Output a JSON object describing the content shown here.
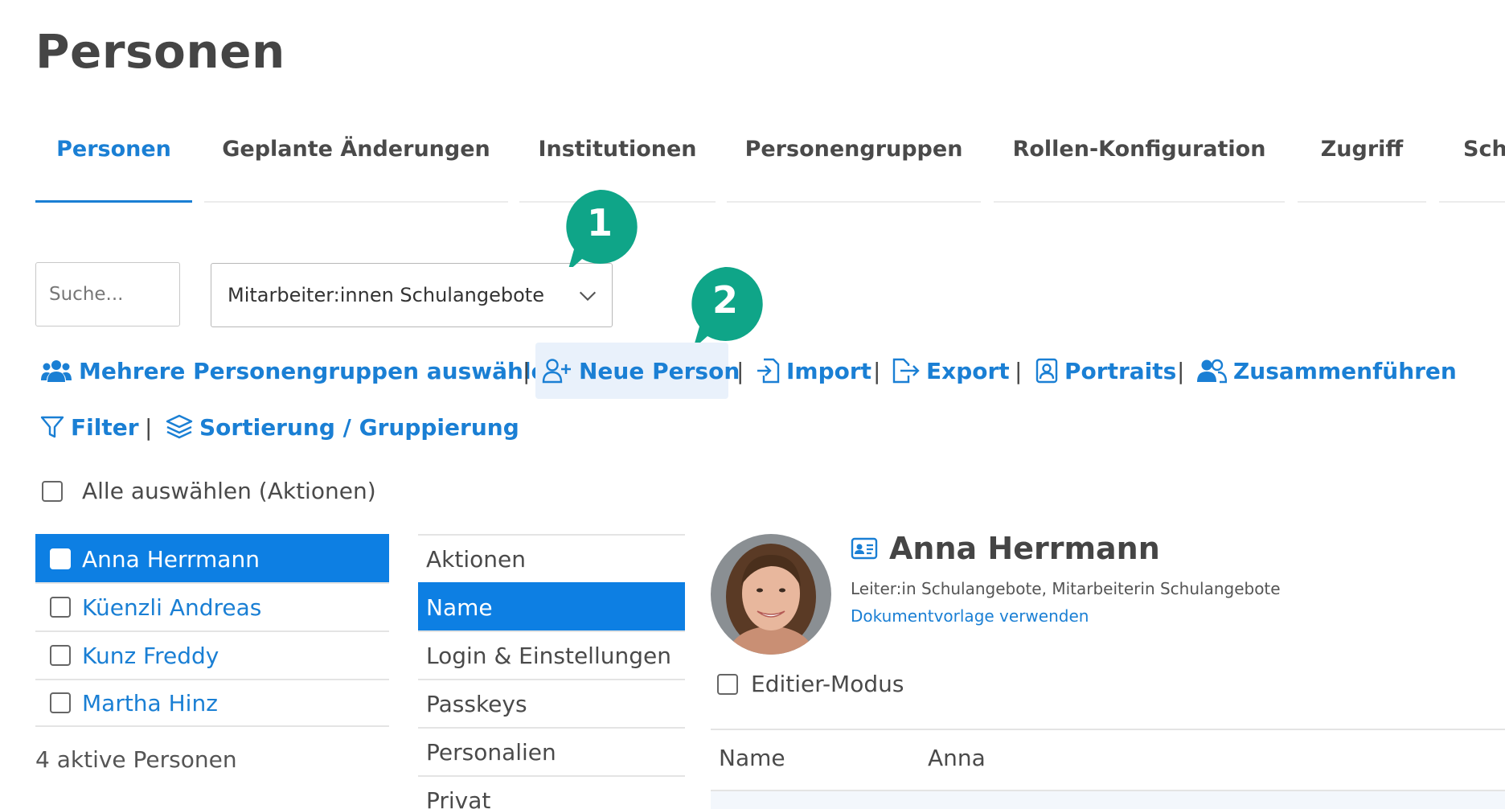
{
  "page": {
    "title": "Personen"
  },
  "tabs": [
    {
      "label": "Personen",
      "active": true
    },
    {
      "label": "Geplante Änderungen"
    },
    {
      "label": "Institutionen"
    },
    {
      "label": "Personengruppen"
    },
    {
      "label": "Rollen-Konfiguration"
    },
    {
      "label": "Zugriff"
    },
    {
      "label": "Sch"
    }
  ],
  "search": {
    "placeholder": "Suche..."
  },
  "group_select": {
    "value": "Mitarbeiter:innen Schulangebote"
  },
  "callouts": [
    "1",
    "2"
  ],
  "toolbar": {
    "multi_groups": "Mehrere Personengruppen auswählen",
    "new_person": "Neue Person",
    "import": "Import",
    "export": "Export",
    "portraits": "Portraits",
    "merge": "Zusammenführen",
    "filter": "Filter",
    "sort_group": "Sortierung / Gruppierung",
    "separator": "|"
  },
  "select_all": "Alle auswählen (Aktionen)",
  "persons": [
    {
      "name": "Anna Herrmann",
      "selected": true
    },
    {
      "name": "Küenzli Andreas"
    },
    {
      "name": "Kunz Freddy"
    },
    {
      "name": "Martha Hinz"
    }
  ],
  "person_count": "4 aktive Personen",
  "sections": [
    {
      "label": "Aktionen"
    },
    {
      "label": "Name",
      "selected": true
    },
    {
      "label": "Login & Einstellungen"
    },
    {
      "label": "Passkeys"
    },
    {
      "label": "Personalien"
    },
    {
      "label": "Privat"
    }
  ],
  "detail": {
    "name": "Anna Herrmann",
    "roles": "Leiter:in Schulangebote, Mitarbeiterin Schulangebote",
    "template_link": "Dokumentvorlage verwenden",
    "edit_mode": "Editier-Modus",
    "field_label": "Name",
    "field_value": "Anna"
  },
  "colors": {
    "accent": "#1a7fd4",
    "selected_bg": "#0d7fe3",
    "callout": "#0fa588"
  }
}
